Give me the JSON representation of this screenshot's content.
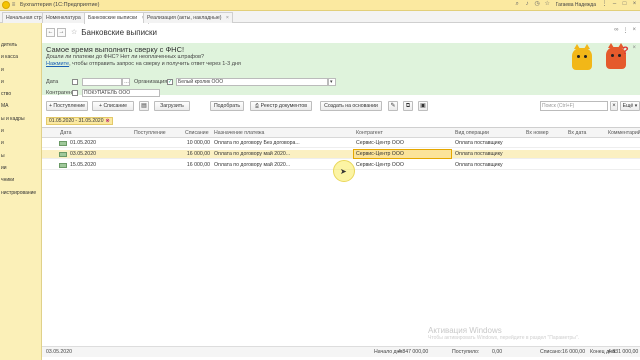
{
  "app": {
    "title": "Бухгалтерия   (1С:Предприятие)",
    "user": "Гагаева Надежда"
  },
  "tabs": [
    {
      "label": "Начальная страница"
    },
    {
      "label": "Номенклатура"
    },
    {
      "label": "Банковские выписки"
    },
    {
      "label": "Реализация (акты, накладные)"
    }
  ],
  "sidebar": {
    "items": [
      "дитель",
      "и касса",
      "и",
      "и",
      "ство",
      "МА",
      "ы и кадры",
      "и",
      "и",
      "ы",
      "ии",
      "чники",
      "нистрирование"
    ]
  },
  "page": {
    "title": "Банковские выписки"
  },
  "banner": {
    "title": "Самое время выполнить сверку с ФНС!",
    "question": "Дошли ли платежи до ФНС? Нет ли неоплаченных штрафов?",
    "link": "Нажмите",
    "rest": ", чтобы отправить запрос на сверку и получить ответ через 1-3 дня"
  },
  "filters": {
    "date_label": "Дата",
    "date_value": "",
    "org_label": "Организация:",
    "org_value": "Белый кролик ООО",
    "contractor_label": "Контрагент",
    "contractor_value": "ПОКУПАТЕЛЬ ООО"
  },
  "toolbar": {
    "income": "+ Поступление",
    "expense": "+ Списание",
    "upload": "Загрузить",
    "match": "Подобрать",
    "registry": "Реестр документов",
    "create_basis": "Создать на основании",
    "search_placeholder": "Поиск (Ctrl+F)"
  },
  "period": {
    "label": "01.05.2020 - 31.05.2020"
  },
  "grid": {
    "columns": [
      "Дата",
      "Поступление",
      "Списание",
      "Назначение платежа",
      "Контрагент",
      "Вид операции",
      "Вх номер",
      "Вх дата",
      "Комментарий"
    ],
    "rows": [
      {
        "date": "01.05.2020",
        "income": "",
        "expense": "10 000,00",
        "purpose": "Оплата по договору Без договора...",
        "contractor": "Сервис-Центр ООО",
        "operation": "Оплата поставщику"
      },
      {
        "date": "03.05.2020",
        "income": "",
        "expense": "16 000,00",
        "purpose": "Оплата по договору май 2020...",
        "contractor": "Сервис-Центр ООО",
        "operation": "Оплата поставщику"
      },
      {
        "date": "15.05.2020",
        "income": "",
        "expense": "16 000,00",
        "purpose": "Оплата по договору май 2020...",
        "contractor": "Сервис-Центр ООО",
        "operation": "Оплата поставщику"
      }
    ]
  },
  "footer": {
    "date": "03.05.2020",
    "start_label": "Начало дня:",
    "start_value": "4 847 000,00",
    "income_label": "Поступило:",
    "income_value": "0,00",
    "expense_label": "Списано:",
    "expense_value": "16 000,00",
    "end_label": "Конец дня:",
    "end_value": "4 831 000,00"
  },
  "watermark": {
    "line1": "Активация Windows",
    "line2": "Чтобы активировать Windows, перейдите в раздел \"Параметры\"."
  }
}
